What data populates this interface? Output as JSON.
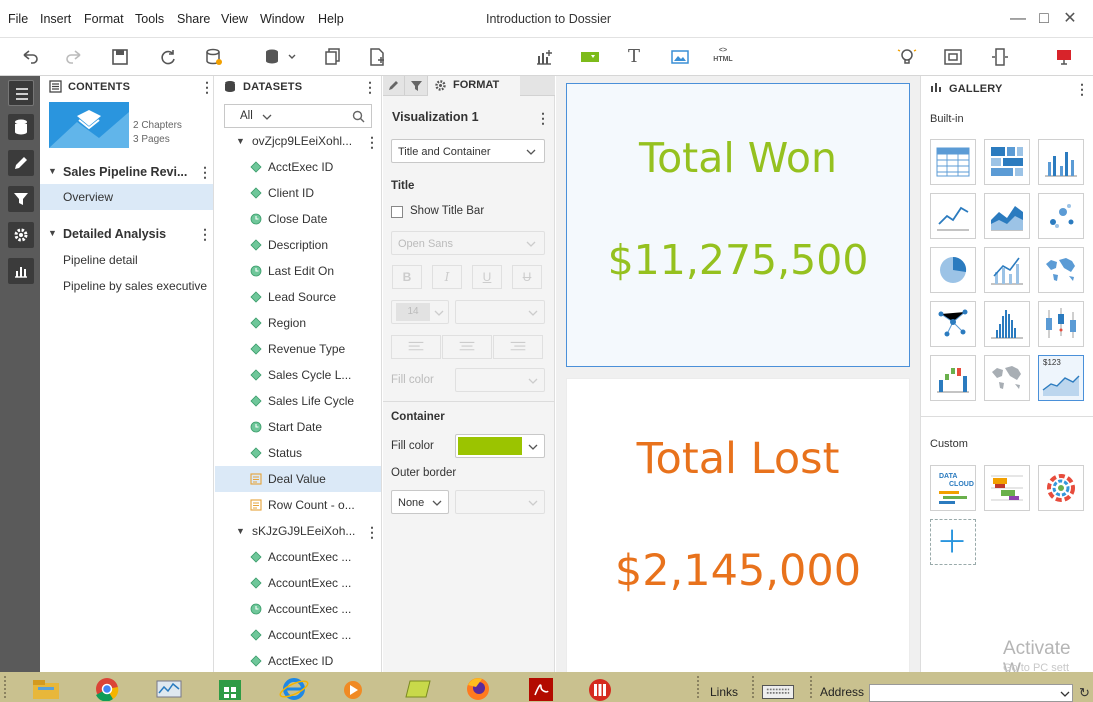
{
  "menu": [
    "File",
    "Insert",
    "Format",
    "Tools",
    "Share",
    "View",
    "Window",
    "Help"
  ],
  "app_title": "Introduction to Dossier",
  "toolbar": {
    "html_label": "HTML"
  },
  "contents": {
    "header": "CONTENTS",
    "thumb_meta": [
      "2 Chapters",
      "3 Pages"
    ],
    "chapters": [
      {
        "title": "Sales Pipeline Revi...",
        "pages": [
          "Overview"
        ]
      },
      {
        "title": "Detailed Analysis",
        "pages": [
          "Pipeline detail",
          "Pipeline by sales executive"
        ]
      }
    ]
  },
  "datasets": {
    "header": "DATASETS",
    "filter_value": "All",
    "groups": [
      {
        "name": "ovZjcp9LEeiXohl...",
        "items": [
          {
            "label": "AcctExec ID",
            "type": "attribute"
          },
          {
            "label": "Client ID",
            "type": "attribute"
          },
          {
            "label": "Close Date",
            "type": "date"
          },
          {
            "label": "Description",
            "type": "attribute"
          },
          {
            "label": "Last Edit On",
            "type": "date"
          },
          {
            "label": "Lead Source",
            "type": "attribute"
          },
          {
            "label": "Region",
            "type": "attribute"
          },
          {
            "label": "Revenue Type",
            "type": "attribute"
          },
          {
            "label": "Sales Cycle L...",
            "type": "attribute"
          },
          {
            "label": "Sales Life Cycle",
            "type": "attribute"
          },
          {
            "label": "Start Date",
            "type": "date"
          },
          {
            "label": "Status",
            "type": "attribute"
          },
          {
            "label": "Deal Value",
            "type": "metric",
            "selected": true
          },
          {
            "label": "Row Count - o...",
            "type": "metric"
          }
        ]
      },
      {
        "name": "sKJzGJ9LEeiXoh...",
        "items": [
          {
            "label": "AccountExec ...",
            "type": "attribute"
          },
          {
            "label": "AccountExec ...",
            "type": "attribute"
          },
          {
            "label": "AccountExec ...",
            "type": "date"
          },
          {
            "label": "AccountExec ...",
            "type": "attribute"
          },
          {
            "label": "AcctExec ID",
            "type": "attribute"
          },
          {
            "label": "Row Count - s...",
            "type": "metric"
          }
        ]
      }
    ]
  },
  "format": {
    "tab_label": "FORMAT",
    "viz_name": "Visualization 1",
    "target": "Title and Container",
    "title_section": "Title",
    "show_title_bar": "Show Title Bar",
    "font": "Open Sans",
    "font_size": "14",
    "fill_color_label": "Fill color",
    "container_section": "Container",
    "container_fill_label": "Fill color",
    "container_fill": "#9bc400",
    "outer_border_label": "Outer border",
    "outer_border_value": "None"
  },
  "canvas": {
    "viz1": {
      "title": "Total Won",
      "value": "$11,275,500",
      "color": "#95c11f"
    },
    "viz2": {
      "title": "Total Lost",
      "value": "$2,145,000",
      "color": "#e8721c"
    }
  },
  "gallery": {
    "header": "GALLERY",
    "builtin_label": "Built-in",
    "custom_label": "Custom",
    "kpi_label": "$123",
    "data_cloud_label": [
      "DATA",
      "CLOUD"
    ]
  },
  "watermark": [
    "Activate W",
    "Go to PC sett"
  ],
  "taskbar": {
    "links_label": "Links",
    "address_label": "Address"
  },
  "colors": {
    "accent": "#4a90d9",
    "rail": "#5a5a5a",
    "selected": "#dbe9f7",
    "taskbar": "#c9c18f"
  }
}
